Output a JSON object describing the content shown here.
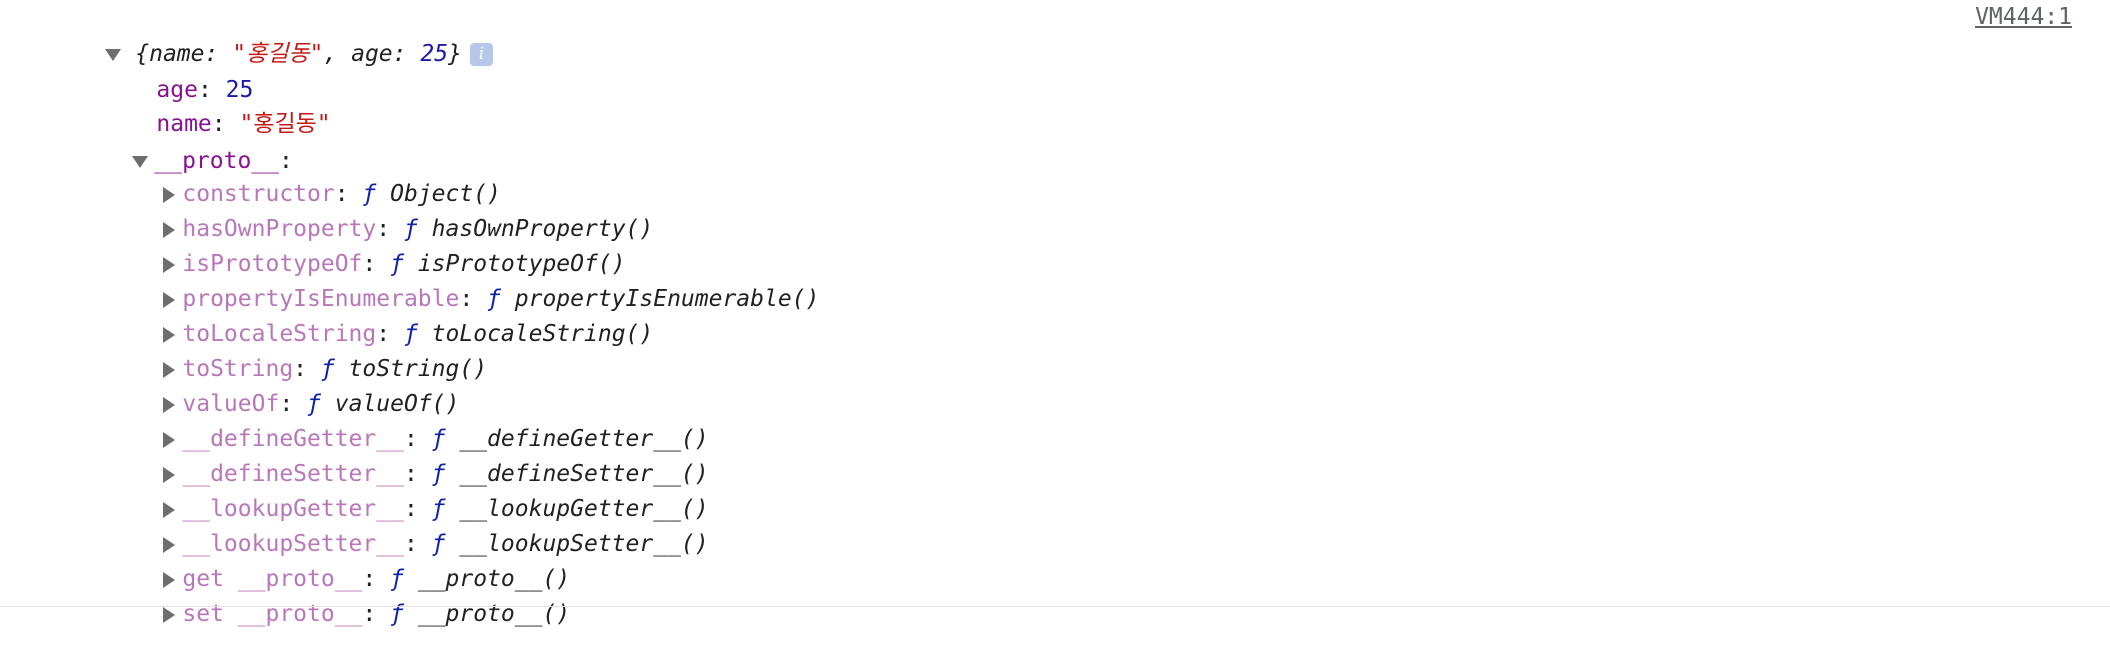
{
  "object": {
    "summary": {
      "open_brace": "{",
      "name_key": "name",
      "colon_sep": ": ",
      "name_value": "\"홍길동\"",
      "comma_sep": ", ",
      "age_key": "age",
      "age_value": "25",
      "close_brace": "}"
    },
    "info_icon": {
      "icon": "info-icon",
      "glyph": "i"
    },
    "own_properties": [
      {
        "key": "age",
        "sep": ": ",
        "value": "25",
        "type": "number"
      },
      {
        "key": "name",
        "sep": ": ",
        "value": "\"홍길동\"",
        "type": "string"
      }
    ],
    "proto": {
      "key": "__proto__",
      "sep": ":",
      "expanded": true,
      "members": [
        {
          "key": "constructor",
          "sep": ": ",
          "f": "ƒ",
          "fn": " Object()"
        },
        {
          "key": "hasOwnProperty",
          "sep": ": ",
          "f": "ƒ",
          "fn": " hasOwnProperty()"
        },
        {
          "key": "isPrototypeOf",
          "sep": ": ",
          "f": "ƒ",
          "fn": " isPrototypeOf()"
        },
        {
          "key": "propertyIsEnumerable",
          "sep": ": ",
          "f": "ƒ",
          "fn": " propertyIsEnumerable()"
        },
        {
          "key": "toLocaleString",
          "sep": ": ",
          "f": "ƒ",
          "fn": " toLocaleString()"
        },
        {
          "key": "toString",
          "sep": ": ",
          "f": "ƒ",
          "fn": " toString()"
        },
        {
          "key": "valueOf",
          "sep": ": ",
          "f": "ƒ",
          "fn": " valueOf()"
        },
        {
          "key": "__defineGetter__",
          "sep": ": ",
          "f": "ƒ",
          "fn": " __defineGetter__()"
        },
        {
          "key": "__defineSetter__",
          "sep": ": ",
          "f": "ƒ",
          "fn": " __defineSetter__()"
        },
        {
          "key": "__lookupGetter__",
          "sep": ": ",
          "f": "ƒ",
          "fn": " __lookupGetter__()"
        },
        {
          "key": "__lookupSetter__",
          "sep": ": ",
          "f": "ƒ",
          "fn": " __lookupSetter__()"
        },
        {
          "key": "get __proto__",
          "sep": ": ",
          "f": "ƒ",
          "fn": " __proto__()"
        },
        {
          "key": "set __proto__",
          "sep": ": ",
          "f": "ƒ",
          "fn": " __proto__()"
        }
      ]
    }
  },
  "source_link": "VM444:1",
  "colors": {
    "own_key": "#881391",
    "proto_key": "#b877b9",
    "string": "#c41a16",
    "number": "#1a1aa6",
    "function_marker": "#0d22aa",
    "info_badge": "#b6c7ea"
  }
}
